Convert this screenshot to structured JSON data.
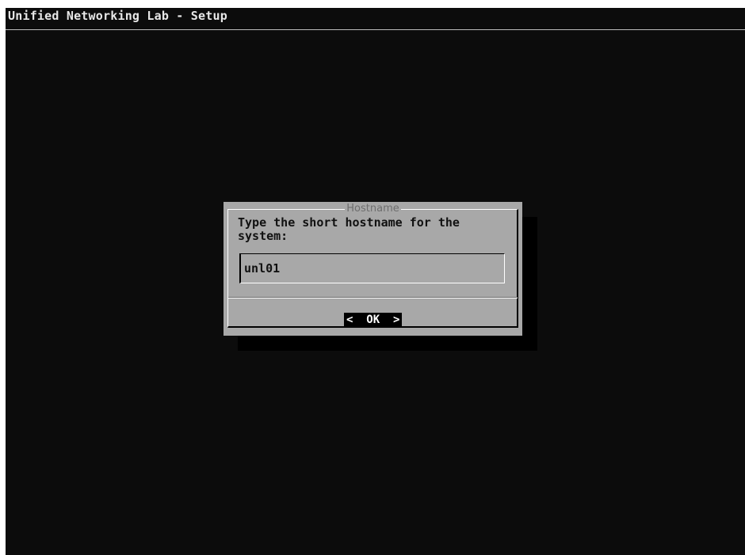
{
  "window": {
    "title": "Unified Networking Lab - Setup"
  },
  "dialog": {
    "title": "Hostname",
    "prompt": "Type the short hostname for the\nsystem:",
    "input_value": "unl01",
    "ok_label": "<  OK  >"
  },
  "colors": {
    "screen_bg": "#0c0c0c",
    "dialog_bg": "#a8a8a8",
    "button_bg": "#000000",
    "title_text": "#e8e8e8"
  }
}
